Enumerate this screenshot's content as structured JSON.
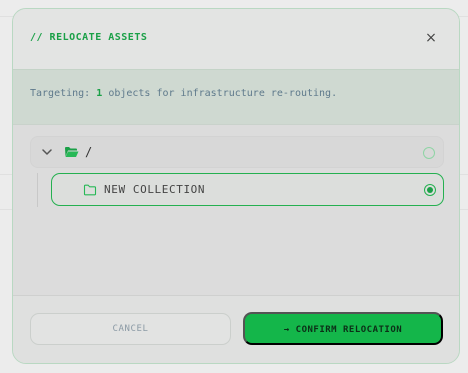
{
  "modal": {
    "title": "// RELOCATE ASSETS",
    "close_icon": "×"
  },
  "info": {
    "prefix": "Targeting:",
    "count": "1",
    "suffix": "objects for infrastructure re-routing."
  },
  "tree": {
    "root": {
      "label": "/",
      "icon": "folder-open-icon",
      "selected": false
    },
    "children": [
      {
        "label": "NEW COLLECTION",
        "icon": "folder-icon",
        "selected": true
      }
    ]
  },
  "footer": {
    "cancel_label": "CANCEL",
    "confirm_label": "→ CONFIRM RELOCATION"
  },
  "colors": {
    "accent": "#1aa047",
    "confirm_bg": "#14b64a",
    "border": "#b9d8c2"
  }
}
